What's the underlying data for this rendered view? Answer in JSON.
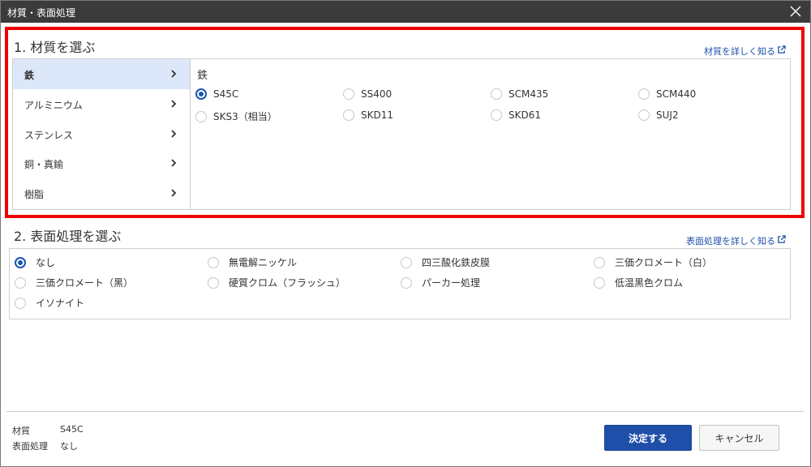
{
  "dialog": {
    "title": "材質・表面処理",
    "close_icon": "close-icon"
  },
  "material": {
    "section_title": "1. 材質を選ぶ",
    "detail_link": "材質を詳しく知る",
    "categories": [
      {
        "label": "鉄",
        "active": true
      },
      {
        "label": "アルミニウム",
        "active": false
      },
      {
        "label": "ステンレス",
        "active": false
      },
      {
        "label": "銅・真鍮",
        "active": false
      },
      {
        "label": "樹脂",
        "active": false
      }
    ],
    "selected_category_heading": "鉄",
    "options": [
      {
        "label": "S45C",
        "checked": true
      },
      {
        "label": "SS400",
        "checked": false
      },
      {
        "label": "SCM435",
        "checked": false
      },
      {
        "label": "SCM440",
        "checked": false
      },
      {
        "label": "SKS3（相当）",
        "checked": false
      },
      {
        "label": "SKD11",
        "checked": false
      },
      {
        "label": "SKD61",
        "checked": false
      },
      {
        "label": "SUJ2",
        "checked": false
      }
    ]
  },
  "surface": {
    "section_title": "2. 表面処理を選ぶ",
    "detail_link": "表面処理を詳しく知る",
    "options": [
      {
        "label": "なし",
        "checked": true
      },
      {
        "label": "無電解ニッケル",
        "checked": false
      },
      {
        "label": "四三酸化鉄皮膜",
        "checked": false
      },
      {
        "label": "三価クロメート（白）",
        "checked": false
      },
      {
        "label": "三価クロメート（黒）",
        "checked": false
      },
      {
        "label": "硬質クロム（フラッシュ）",
        "checked": false
      },
      {
        "label": "パーカー処理",
        "checked": false
      },
      {
        "label": "低温黒色クロム",
        "checked": false
      },
      {
        "label": "イソナイト",
        "checked": false
      }
    ]
  },
  "summary": {
    "material_label": "材質",
    "material_value": "S45C",
    "surface_label": "表面処理",
    "surface_value": "なし"
  },
  "buttons": {
    "confirm": "決定する",
    "cancel": "キャンセル"
  },
  "colors": {
    "accent": "#1f4fa8",
    "highlight_border": "#ee0000",
    "active_category_bg": "#dce8f9",
    "titlebar_bg": "#3b3b3b"
  }
}
